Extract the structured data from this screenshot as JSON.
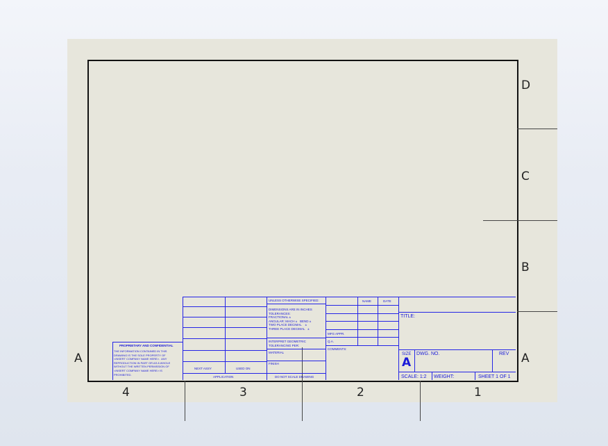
{
  "zones": {
    "letters_right": [
      "D",
      "C",
      "B",
      "A"
    ],
    "letters_left": [
      "A"
    ],
    "numbers": [
      "4",
      "3",
      "2",
      "1"
    ]
  },
  "title_block": {
    "tolerance_header": "UNLESS OTHERWISE SPECIFIED:",
    "tolerance_lines": "DIMENSIONS ARE IN INCHES\nTOLERANCES:\nFRACTIONAL ±\nANGULAR: MACH ±   BEND ±\nTWO PLACE DECIMAL    ±\nTHREE PLACE DECIMAL   ±",
    "interpret": "INTERPRET GEOMETRIC\nTOLERANCING PER:",
    "material": "MATERIAL",
    "finish": "FINISH",
    "do_not_scale": "DO NOT SCALE DRAWING",
    "next_assy": "NEXT ASSY",
    "used_on": "USED ON",
    "application": "APPLICATION",
    "name_header": "NAME",
    "date_header": "DATE",
    "mfg_appr": "MFG APPR.",
    "qa": "Q.A.",
    "comments": "COMMENTS:",
    "title_label": "TITLE:",
    "size_label": "SIZE",
    "size_value": "A",
    "dwg_no_label": "DWG.  NO.",
    "rev_label": "REV",
    "scale": "SCALE: 1:2",
    "weight": "WEIGHT:",
    "sheet": "SHEET 1 OF 1",
    "proprietary_title": "PROPRIETARY AND CONFIDENTIAL",
    "proprietary_text": "THE INFORMATION CONTAINED IN THIS\nDRAWING IS THE SOLE PROPERTY OF\n<INSERT COMPANY NAME HERE>.  ANY\nREPRODUCTION IN PART OR AS A WHOLE\nWITHOUT THE WRITTEN PERMISSION OF\n<INSERT COMPANY NAME HERE> IS\nPROHIBITED."
  }
}
